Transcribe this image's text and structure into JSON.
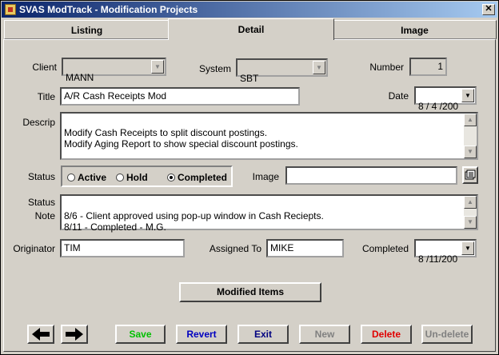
{
  "window": {
    "title": "SVAS ModTrack - Modification Projects",
    "close_label": "✕"
  },
  "tabs": [
    {
      "label": "Listing"
    },
    {
      "label": "Detail"
    },
    {
      "label": "Image"
    }
  ],
  "form": {
    "client_label": "Client",
    "client_value": "MANN",
    "system_label": "System",
    "system_value": "SBT",
    "number_label": "Number",
    "number_value": "1",
    "title_label": "Title",
    "title_value": "A/R Cash Receipts Mod",
    "date_label": "Date",
    "date_value": "8 / 4 /200",
    "descrip_label": "Descrip",
    "descrip_value": "Modify Cash Receipts to split discount postings.\nModify Aging Report to show special discount postings.",
    "status_label": "Status",
    "status_options": [
      {
        "label": "Active",
        "selected": false
      },
      {
        "label": "Hold",
        "selected": false
      },
      {
        "label": "Completed",
        "selected": true
      }
    ],
    "image_label": "Image",
    "image_value": "",
    "status_note_label_1": "Status",
    "status_note_label_2": "Note",
    "status_note_value": "8/6 - Client approved using pop-up window in Cash Reciepts.\n8/11 - Completed - M.G.",
    "originator_label": "Originator",
    "originator_value": "TIM",
    "assigned_label": "Assigned To",
    "assigned_value": "MIKE",
    "completed_label": "Completed",
    "completed_value": "8 /11/200"
  },
  "buttons": {
    "modified_items": "Modified Items",
    "save": "Save",
    "revert": "Revert",
    "exit": "Exit",
    "new": "New",
    "delete": "Delete",
    "undelete": "Un-delete"
  },
  "colors": {
    "save": "#00c000",
    "revert": "#0000c0",
    "exit": "#000080",
    "disabled": "#808080",
    "delete": "#e00000"
  },
  "icons": {
    "prev": "left-arrow-icon",
    "next": "right-arrow-icon",
    "browse": "browse-file-icon",
    "dropdown": "chevron-down-icon"
  }
}
